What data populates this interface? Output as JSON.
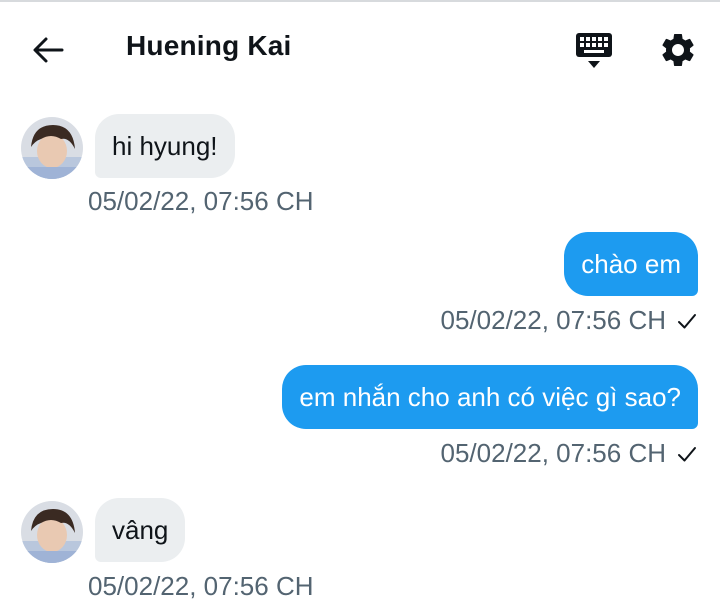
{
  "header": {
    "title": "Huening Kai",
    "back_icon": "arrow-left-icon",
    "keyboard_icon": "keyboard-icon",
    "settings_icon": "gear-icon"
  },
  "messages": [
    {
      "direction": "in",
      "text": "hi hyung!",
      "timestamp": "05/02/22, 07:56 CH"
    },
    {
      "direction": "out",
      "text": "chào em",
      "timestamp": "05/02/22, 07:56 CH",
      "status_icon": "checkmark-icon"
    },
    {
      "direction": "out",
      "text": "em nhắn cho anh có việc gì sao?",
      "timestamp": "05/02/22, 07:56 CH",
      "status_icon": "checkmark-icon"
    },
    {
      "direction": "in",
      "text": "vâng",
      "timestamp": "05/02/22, 07:56 CH"
    }
  ],
  "colors": {
    "outgoing_bubble": "#1d9bf0",
    "incoming_bubble": "#ebeef0",
    "timestamp": "#536471",
    "title": "#0f1419"
  }
}
